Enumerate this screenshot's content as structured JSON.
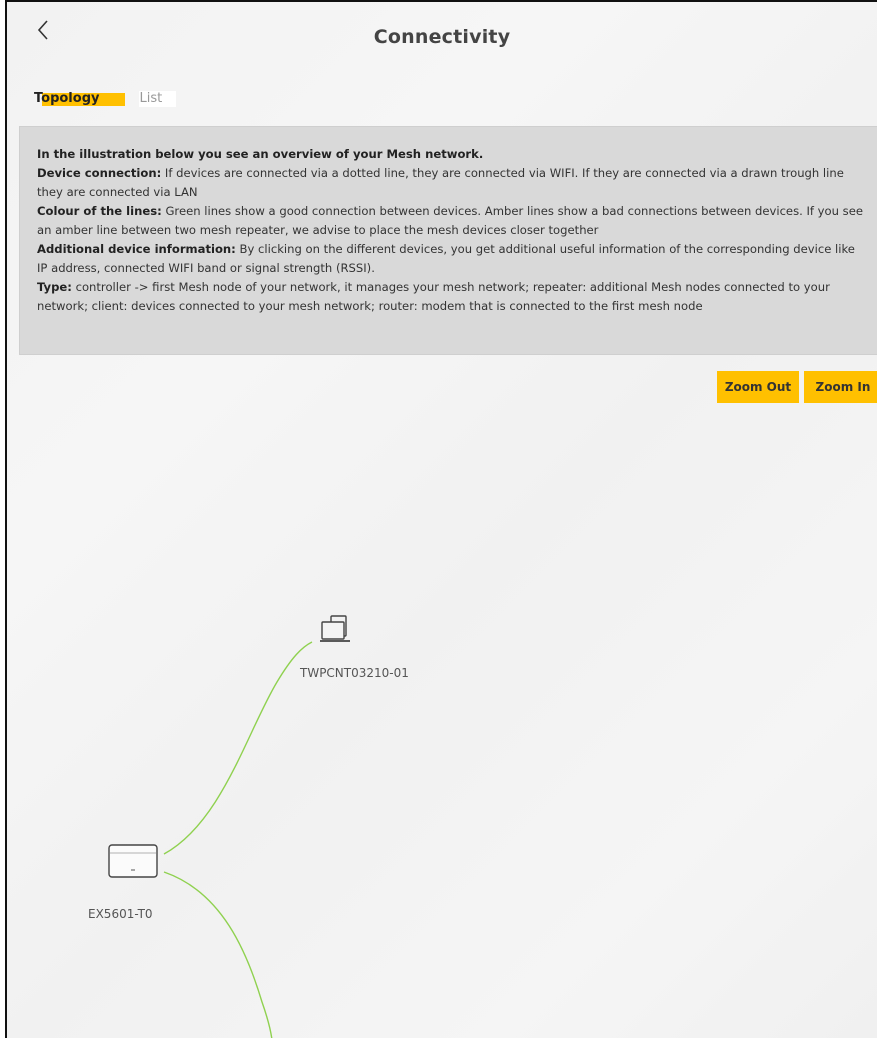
{
  "header": {
    "title": "Connectivity",
    "back_icon": "chevron-left-icon"
  },
  "tabs": [
    {
      "label": "Topology",
      "active": true
    },
    {
      "label": "List",
      "active": false
    }
  ],
  "info": {
    "intro": "In the illustration below you see an overview of your Mesh network.",
    "device_connection_title": "Device connection:",
    "device_connection_text": " If devices are connected via a dotted line, they are connected via WIFI. If they are connected via a drawn trough line they are connected via LAN",
    "colour_title": "Colour of the lines:",
    "colour_text": " Green lines show a good connection between devices. Amber lines show a bad connections between devices. If you see an amber line between two mesh repeater, we advise to place the mesh devices closer together",
    "additional_title": "Additional device information:",
    "additional_text": " By clicking on the different devices, you get additional useful information of the corresponding device like IP address, connected WIFI band or signal strength (RSSI).",
    "type_title": "Type:",
    "type_text": " controller -> first Mesh node of your network, it manages your mesh network; repeater: additional Mesh nodes connected to your network; client: devices connected to your mesh network; router: modem that is connected to the first mesh node"
  },
  "zoom": {
    "out_label": "Zoom Out",
    "in_label": "Zoom In"
  },
  "topology": {
    "nodes": [
      {
        "name": "EX5601-T0",
        "type": "controller",
        "icon": "router-icon"
      },
      {
        "name": "TWPCNT03210-01",
        "type": "client",
        "icon": "computer-icon"
      }
    ],
    "good_link_color": "#8fd14f",
    "accent_color": "#ffc000"
  }
}
